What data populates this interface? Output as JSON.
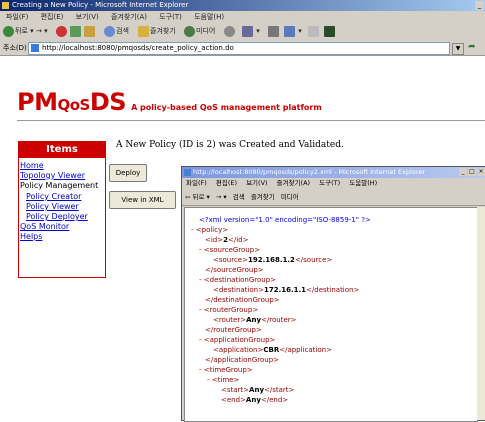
{
  "window": {
    "title": "Creating a New Policy - Microsoft Internet Explorer",
    "menu": [
      "파일(F)",
      "편집(E)",
      "보기(V)",
      "즐겨찾기(A)",
      "도구(T)",
      "도움말(H)"
    ],
    "toolbar": {
      "back": "뒤로",
      "search": "검색",
      "favorites": "즐겨찾기",
      "media": "미디어"
    },
    "address_label": "주소(D)",
    "address": "http://localhost:8080/pmqosds/create_policy_action.do"
  },
  "logo": {
    "pm": "PM",
    "qos": "QoS",
    "ds": "DS",
    "tagline": "A policy-based QoS management platform"
  },
  "nav": {
    "heading": "Items",
    "home": "Home",
    "topology_viewer": "Topology Viewer",
    "policy_management": "Policy Management",
    "policy_creator": "Policy Creator",
    "policy_viewer": "Policy Viewer",
    "policy_deployer": "Policy Deployer",
    "qos_monitor": "QoS Monitor",
    "helps": "Helps"
  },
  "main": {
    "message": "A New Policy (ID is 2) was Created and Validated.",
    "deploy_button": "Deploy",
    "view_xml_button": "View in XML"
  },
  "popup": {
    "title": "http://localhost:8080/pmqosds/policy2.xml - Microsoft Internet Explorer",
    "menu": [
      "파일(F)",
      "편집(E)",
      "보기(V)",
      "즐겨찾기(A)",
      "도구(T)",
      "도움말(H)"
    ],
    "toolbar": {
      "back": "뒤로",
      "search": "검색",
      "favorites": "즐겨찾기",
      "media": "미디어"
    },
    "xml": {
      "declaration": "<?xml version=\"1.0\" encoding=\"ISO-8859-1\" ?>",
      "policy_open": "<policy>",
      "policy_id": "2",
      "source_open": "<sourceGroup>",
      "source": "192.168.1.2",
      "source_close": "</sourceGroup>",
      "dest_open": "<destinationGroup>",
      "destination": "172.16.1.1",
      "dest_close": "</destinationGroup>",
      "router_open": "<routerGroup>",
      "router": "Any",
      "router_close": "</routerGroup>",
      "app_open": "<applicationGroup>",
      "application": "CBR",
      "app_close": "</applicationGroup>",
      "time_group_open": "<timeGroup>",
      "time_open": "<time>",
      "start": "Any",
      "end": "Any"
    }
  }
}
